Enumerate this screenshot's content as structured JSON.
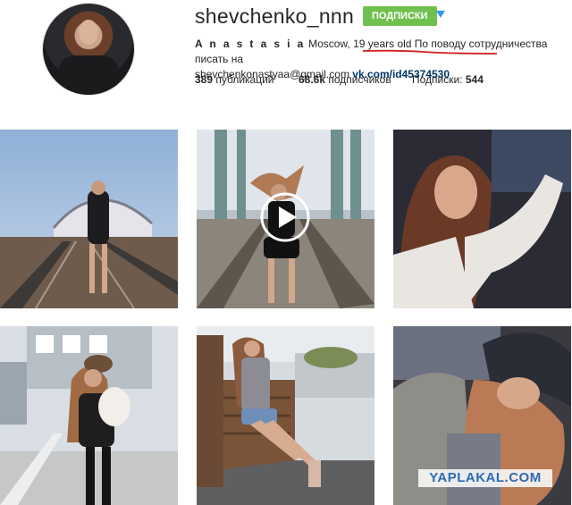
{
  "profile": {
    "username": "shevchenko_nnn",
    "follow_label": "ПОДПИСКИ",
    "bio_name": "A n a s t a s i a",
    "bio_text_1": " Moscow, 19 years old ",
    "bio_text_2": "По поводу сотрудничества писать на",
    "bio_email": "shevchenkonastyaa@gmail.com ",
    "bio_link": "vk.com/id45374530"
  },
  "stats": {
    "posts_value": "389",
    "posts_label": " публикаций",
    "followers_value": "68.6k",
    "followers_label": " подписчиков",
    "following_label": "Подписки: ",
    "following_value": "544"
  },
  "colors": {
    "follow_green": "#70c050",
    "link_blue": "#003569",
    "annotation_red": "#d02020"
  },
  "posts": [
    {
      "icon": "image"
    },
    {
      "icon": "video-play-icon"
    },
    {
      "icon": "image"
    },
    {
      "icon": "image"
    },
    {
      "icon": "image"
    },
    {
      "icon": "image"
    }
  ],
  "watermark": "YAPLAKAL.COM"
}
